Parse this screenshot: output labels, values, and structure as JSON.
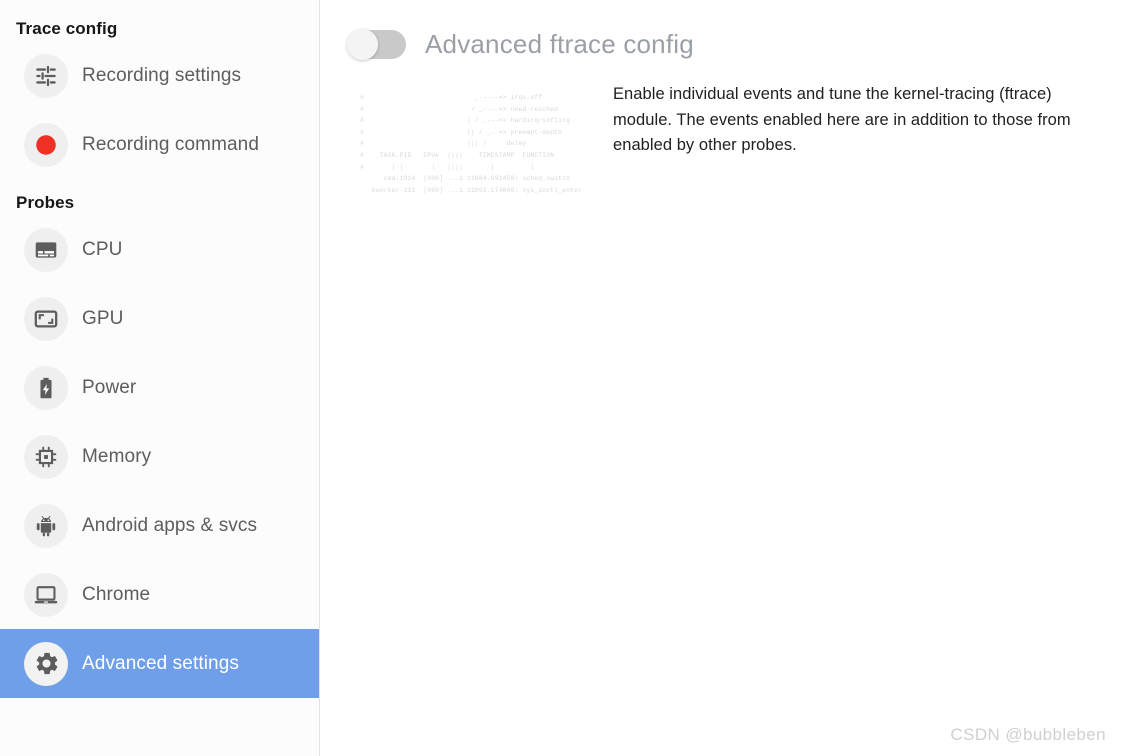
{
  "sidebar": {
    "trace_config_heading": "Trace config",
    "probes_heading": "Probes",
    "trace_items": [
      {
        "label": "Recording settings",
        "icon": "tune-sliders-icon"
      },
      {
        "label": "Recording command",
        "icon": "record-circle-icon"
      }
    ],
    "probe_items": [
      {
        "label": "CPU",
        "icon": "cpu-card-icon"
      },
      {
        "label": "GPU",
        "icon": "gpu-aspect-ratio-icon"
      },
      {
        "label": "Power",
        "icon": "battery-bolt-icon"
      },
      {
        "label": "Memory",
        "icon": "memory-chip-icon"
      },
      {
        "label": "Android apps & svcs",
        "icon": "android-robot-icon"
      },
      {
        "label": "Chrome",
        "icon": "laptop-icon"
      },
      {
        "label": "Advanced settings",
        "icon": "gear-icon",
        "selected": true
      }
    ]
  },
  "main": {
    "probe_title": "Advanced ftrace config",
    "toggle_state": "off",
    "description": "Enable individual events and tune the kernel-tracing (ftrace) module. The events enabled here are in addition to those from enabled by other probes.",
    "ascii_art": "#                            _-----=> irqs-off\n#                           / _----=> need-resched\n#                          | / _---=> hardirq/softirq\n#                          || / _--=> preempt-depth\n#                          ||| /     delay\n#    TASK-PID   CPU#  ||||    TIMESTAMP  FUNCTION\n#       | |       |   ||||       |         |\n      cmd-1914  [000] ...1 11084.991450: sched_switch\n   kworker-111  [000] ...1 11091.174048: sys_ioctl_enter"
  },
  "watermark": {
    "text": "CSDN @bubbleben"
  },
  "colors": {
    "selected_blue": "#6f9fe8",
    "record_red": "#ee3124",
    "icon_gray": "#5d5d5d",
    "sidebar_bg": "#fcfcfc",
    "title_gray": "#9aa0a6"
  }
}
